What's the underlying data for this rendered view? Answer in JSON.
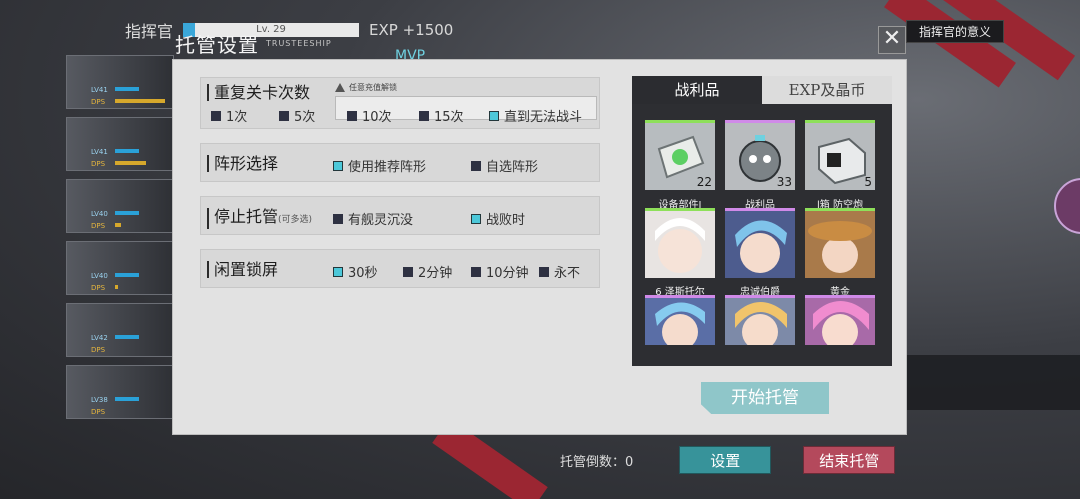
{
  "hud": {
    "commander_label": "指挥官",
    "level": "Lv. 29",
    "exp": "EXP +1500",
    "mvp": "MVP",
    "top_right": "指挥官的意义"
  },
  "fleet": [
    {
      "lv": "LV41",
      "dps": "DPS",
      "dps_fraction": 0.9
    },
    {
      "lv": "LV41",
      "dps": "DPS",
      "dps_fraction": 0.55
    },
    {
      "lv": "LV40",
      "dps": "DPS",
      "dps_fraction": 0.1
    },
    {
      "lv": "LV40",
      "dps": "DPS",
      "dps_fraction": 0.05
    },
    {
      "lv": "LV42",
      "dps": "DPS",
      "dps_fraction": 0.0
    },
    {
      "lv": "LV38",
      "dps": "DPS",
      "dps_fraction": 0.0
    }
  ],
  "dialog": {
    "title": "托管设置",
    "subtitle": "TRUSTEESHIP",
    "close": "✕",
    "repeat": {
      "title": "重复关卡次数",
      "note": "任意充值解锁",
      "options": [
        {
          "label": "1次",
          "checked": false
        },
        {
          "label": "5次",
          "checked": false
        },
        {
          "label": "10次",
          "checked": false
        },
        {
          "label": "15次",
          "checked": false
        },
        {
          "label": "直到无法战斗",
          "checked": true
        }
      ]
    },
    "formation": {
      "title": "阵形选择",
      "options": [
        {
          "label": "使用推荐阵形",
          "checked": true
        },
        {
          "label": "自选阵形",
          "checked": false
        }
      ]
    },
    "stop": {
      "title": "停止托管",
      "hint": "(可多选)",
      "options": [
        {
          "label": "有舰灵沉没",
          "checked": false
        },
        {
          "label": "战败时",
          "checked": true
        }
      ]
    },
    "idle": {
      "title": "闲置锁屏",
      "options": [
        {
          "label": "30秒",
          "checked": true
        },
        {
          "label": "2分钟",
          "checked": false
        },
        {
          "label": "10分钟",
          "checked": false
        },
        {
          "label": "永不",
          "checked": false
        }
      ]
    },
    "loot": {
      "tabs": [
        "战利品",
        "EXP及晶币"
      ],
      "items": [
        {
          "label": "设备部件I",
          "count": "22",
          "icon": "equipment-part-icon"
        },
        {
          "label": "战利品",
          "count": "33",
          "icon": "loot-pufferfish-icon"
        },
        {
          "label": "l箱   防空炮",
          "count": "5",
          "icon": "supply-box-icon"
        },
        {
          "label": "6   泽斯托尔",
          "count": "",
          "icon": "character-white-hair"
        },
        {
          "label": "忠诚伯爵",
          "count": "",
          "icon": "character-blue-hair"
        },
        {
          "label": "黄金",
          "count": "",
          "icon": "character-cowboy-hat"
        },
        {
          "label": "",
          "count": "",
          "icon": "character-blue-hair-2"
        },
        {
          "label": "",
          "count": "",
          "icon": "character-blonde"
        },
        {
          "label": "",
          "count": "",
          "icon": "character-pink-hair"
        }
      ]
    },
    "start": "开始托管"
  },
  "bottom": {
    "count": "托管倒数：0",
    "settings": "设置",
    "end": "结束托管"
  }
}
